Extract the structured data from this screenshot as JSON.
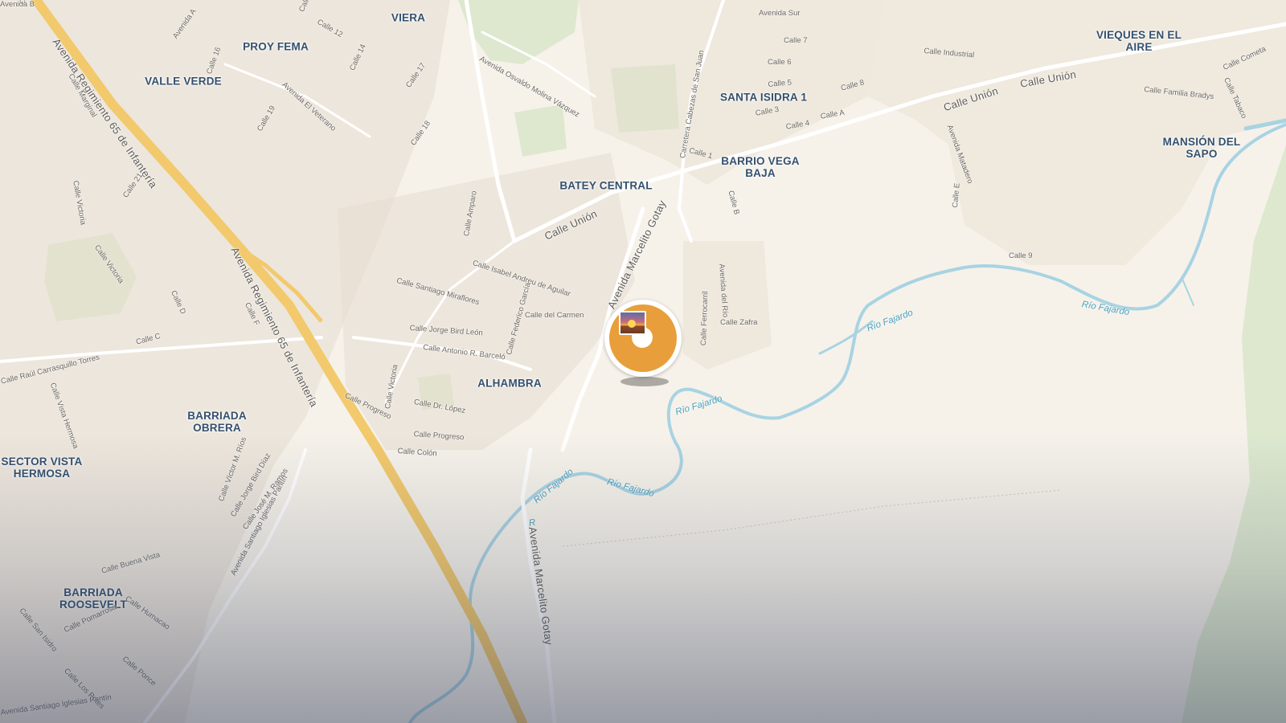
{
  "map": {
    "colors": {
      "land": "#f6f2ea",
      "green": "#dde8cf",
      "water": "#a8d3e3",
      "highway": "#f2c96c",
      "road": "#ffffff",
      "building": "#e6ddd0",
      "marker": "#e89e3a"
    },
    "areas": [
      {
        "name": "VIERA"
      },
      {
        "name": "PROY FEMA"
      },
      {
        "name": "VALLE VERDE"
      },
      {
        "name": "VIEQUES EN EL\nAIRE"
      },
      {
        "name": "SANTA ISIDRA 1"
      },
      {
        "name": "MANSIÓN DEL\nSAPO"
      },
      {
        "name": "BARRIO VEGA\nBAJA"
      },
      {
        "name": "BATEY CENTRAL"
      },
      {
        "name": "ALHAMBRA"
      },
      {
        "name": "BARRIADA\nOBRERA"
      },
      {
        "name": "SECTOR VISTA\nHERMOSA"
      },
      {
        "name": "BARRIADA\nROOSEVELT"
      }
    ],
    "roads": [
      {
        "name": "Avenida Regimiento 65 de Infantería"
      },
      {
        "name": "Avenida Regimiento 65 de Infantería"
      },
      {
        "name": "Calle Unión"
      },
      {
        "name": "Calle Unión"
      },
      {
        "name": "Calle Unión"
      },
      {
        "name": "Avenida Marcelito Gotay"
      },
      {
        "name": "Avenida Marcelito Gotay"
      },
      {
        "name": "Carretera Cabezas de San Juan"
      },
      {
        "name": "Avenida Osvaldo Molina Vázquez"
      },
      {
        "name": "Avenida El Veterano"
      },
      {
        "name": "Calle Raúl Carrasquillo Torres"
      },
      {
        "name": "Avenida Santiago Iglesias Pantín"
      },
      {
        "name": "Avenida Santiago Iglesias Pantín"
      },
      {
        "name": "Calle Industrial"
      },
      {
        "name": "Calle Familia Bradys"
      },
      {
        "name": "Avenida Sur"
      },
      {
        "name": "Avenida Matadero"
      },
      {
        "name": "Calle Isabel Andreu de Aguilar"
      },
      {
        "name": "Calle Santiago Miraflores"
      },
      {
        "name": "Calle del Carmen"
      },
      {
        "name": "Calle Jorge Bird León"
      },
      {
        "name": "Calle Antonio R. Barceló"
      },
      {
        "name": "Calle Federico García"
      },
      {
        "name": "Calle Dr. López"
      },
      {
        "name": "Calle Progreso"
      },
      {
        "name": "Calle Progreso"
      },
      {
        "name": "Calle Colón"
      },
      {
        "name": "Calle Zafra"
      },
      {
        "name": "Calle Ferrocarril"
      },
      {
        "name": "Avenida del Río"
      },
      {
        "name": "Calle Victoria"
      },
      {
        "name": "Calle Victoria"
      },
      {
        "name": "Calle Victoria"
      },
      {
        "name": "Calle Amparo"
      },
      {
        "name": "Calle Marginal"
      },
      {
        "name": "Calle Buena Vista"
      },
      {
        "name": "Calle Humacao"
      },
      {
        "name": "Calle Pomarrosa"
      },
      {
        "name": "Calle San Isidro"
      },
      {
        "name": "Calle Ponce"
      },
      {
        "name": "Calle Los Potes"
      },
      {
        "name": "Calle Víctor M. Ríos"
      },
      {
        "name": "Calle Jorge Bird Díaz"
      },
      {
        "name": "Calle José M. Ramos"
      },
      {
        "name": "Calle Vista Hermosa"
      },
      {
        "name": "Calle Cometa"
      },
      {
        "name": "Calle Tabaco"
      },
      {
        "name": "Calle 1"
      },
      {
        "name": "Calle 3"
      },
      {
        "name": "Calle 4"
      },
      {
        "name": "Calle 5"
      },
      {
        "name": "Calle 6"
      },
      {
        "name": "Calle 7"
      },
      {
        "name": "Calle 8"
      },
      {
        "name": "Calle 9"
      },
      {
        "name": "Calle 10"
      },
      {
        "name": "Calle 12"
      },
      {
        "name": "Calle 14"
      },
      {
        "name": "Calle 16"
      },
      {
        "name": "Calle 17"
      },
      {
        "name": "Calle 18"
      },
      {
        "name": "Calle 19"
      },
      {
        "name": "Calle 21"
      },
      {
        "name": "Calle A"
      },
      {
        "name": "Calle B"
      },
      {
        "name": "Calle C"
      },
      {
        "name": "Calle D"
      },
      {
        "name": "Calle E"
      },
      {
        "name": "Calle F"
      },
      {
        "name": "Calle 2"
      },
      {
        "name": "Avenida A"
      },
      {
        "name": "Avenida B"
      }
    ],
    "rivers": [
      {
        "name": "Río Fajardo"
      },
      {
        "name": "Río Fajardo"
      },
      {
        "name": "Río Fajardo"
      },
      {
        "name": "Río Fajardo"
      },
      {
        "name": "Río Fajardo"
      },
      {
        "name": "R"
      }
    ],
    "marker": {
      "icon": "photo-marker-icon"
    }
  }
}
